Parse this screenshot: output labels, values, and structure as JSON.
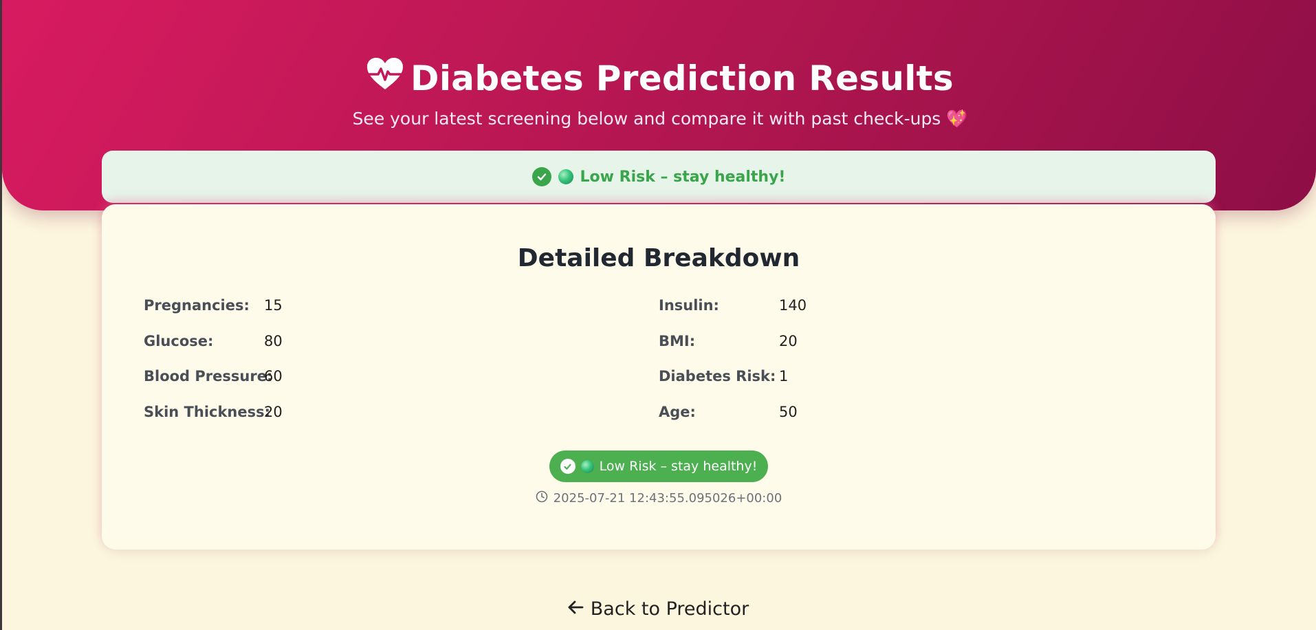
{
  "header": {
    "title": "Diabetes Prediction Results",
    "subtitle": "See your latest screening below and compare it with past check-ups 💖",
    "title_icon": "heart-pulse-icon"
  },
  "alert": {
    "text": "Low Risk – stay healthy!",
    "status_color": "#3aa54a"
  },
  "breakdown": {
    "title": "Detailed Breakdown",
    "left": [
      {
        "label": "Pregnancies:",
        "value": "15"
      },
      {
        "label": "Glucose:",
        "value": "80"
      },
      {
        "label": "Blood Pressure:",
        "value": "60"
      },
      {
        "label": "Skin Thickness:",
        "value": "20"
      }
    ],
    "right": [
      {
        "label": "Insulin:",
        "value": "140"
      },
      {
        "label": "BMI:",
        "value": "20"
      },
      {
        "label": "Diabetes Risk:",
        "value": "1"
      },
      {
        "label": "Age:",
        "value": "50"
      }
    ],
    "badge": "Low Risk – stay healthy!",
    "timestamp": "2025-07-21 12:43:55.095026+00:00"
  },
  "nav": {
    "back_label": "Back to Predictor"
  },
  "colors": {
    "brand": "#d81b60",
    "brand_dark": "#8e0e46",
    "background": "#fdf6de",
    "success": "#4caf50"
  }
}
